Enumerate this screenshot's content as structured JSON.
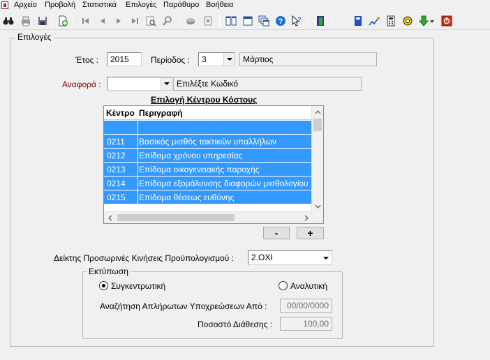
{
  "menu": {
    "items": [
      "Αρχείο",
      "Προβολή",
      "Στατιστικά",
      "Επιλογές",
      "Παράθυρο",
      "Βοήθεια"
    ]
  },
  "toolbar": {
    "icons": [
      "binoculars-icon",
      "print-icon",
      "save-icon",
      "new-document-icon",
      "first-record-icon",
      "previous-record-icon",
      "next-record-icon",
      "last-record-icon",
      "print-preview-icon",
      "search-icon",
      "database-icon",
      "export-icon",
      "tile-vertical-icon",
      "window-icon",
      "cascade-icon",
      "help-icon",
      "context-help-icon",
      "exit-door-icon",
      "book-icon",
      "chart-icon",
      "calculator-icon",
      "settings-icon",
      "download-arrow-icon",
      "close-icon"
    ]
  },
  "options": {
    "legend": "Επιλογές",
    "year_label": "Έτος :",
    "year_value": "2015",
    "period_label": "Περίοδος :",
    "period_value": "3",
    "month_name": "Μάρτιος",
    "report_label": "Αναφορά :",
    "report_value": "",
    "report_hint": "Επιλέξτε Κωδικό",
    "cost_center_title": "Επιλογή Κέντρου Κόστους"
  },
  "grid": {
    "columns": [
      "Κέντρο",
      "Περιγραφή"
    ],
    "rows": [
      {
        "code": "",
        "description": ""
      },
      {
        "code": "0211",
        "description": "Βασικός μισθός τακτικών υπαλλήλων"
      },
      {
        "code": "0212",
        "description": "Επίδομα χρόνου υπηρεσίας"
      },
      {
        "code": "0213",
        "description": "Επίδομα οικογενειακής παροχής"
      },
      {
        "code": "0214",
        "description": "Επίδομα εξομάλυνσης διαφορών μισθολογίου"
      },
      {
        "code": "0215",
        "description": "Επίδομα θέσεως ευθύνης"
      }
    ]
  },
  "buttons": {
    "minus": "-",
    "plus": "+"
  },
  "indicator": {
    "label": "Δείκτης Προσωρινές Κινήσεις Προϋπολογισμού :",
    "value": "2.ΟΧΙ"
  },
  "print": {
    "legend": "Εκτύπωση",
    "option_summary": "Συγκεντρωτική",
    "option_analytic": "Αναλυτική",
    "selected": "summary",
    "search_label": "Αναζήτηση Απλήρωτων Υποχρεώσεων Από :",
    "search_date": "00/00/0000",
    "percent_label": "Ποσοστό Διάθεσης :",
    "percent_value": "100,00"
  }
}
